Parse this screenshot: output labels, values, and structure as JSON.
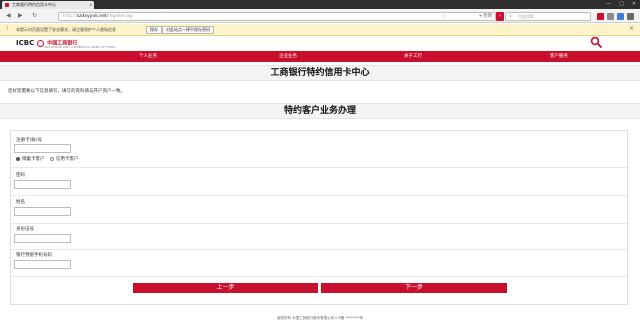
{
  "browser": {
    "tab_title": "工商银行特约信用卡中心",
    "tab_close": "x",
    "window_buttons": [
      "—",
      "□",
      "✕"
    ],
    "nav": {
      "back": "◀",
      "forward": "▶",
      "refresh": "↻"
    },
    "url_scheme": "http://",
    "url_host": "szdxyynk.net",
    "url_path": "/register.jsp",
    "url_right": "▾ 原网",
    "star": "☆",
    "go": "›",
    "search_placeholder": "百度搜索",
    "search_glyph": "⌕"
  },
  "infobar": {
    "icon": "!",
    "text": "本提示对页面设置了安全模式，请注意保护个人隐私信息",
    "allow_button": "保存",
    "never_button": "对此站点一律不保存密码",
    "close": "✕"
  },
  "bank": {
    "logo_text": "ICBC",
    "logo_cn": "中国工商银行",
    "logo_sub": "INDUSTRIAL AND COMMERCIAL BANK OF CHINA",
    "menu": [
      "个人业务",
      "企业业务",
      "关于工行",
      "客户服务"
    ],
    "page_title": "工商银行特约信用卡中心",
    "note": "您好您需要以下信息填写，填写的资料请与开户资户一致。",
    "section_title": "特约客户业务办理",
    "form": {
      "card_label": "注册卡(账)号",
      "account_type_options": [
        "储蓄卡客户",
        "信用卡客户"
      ],
      "password_label": "密码",
      "name_label": "姓名",
      "id_label": "身份证号",
      "phone_label": "银行预留手机号码"
    },
    "prev_button": "上一步",
    "next_button": "下一步",
    "footer": "版权所有 中国工商银行股份有限公司 ICP备 ********号"
  },
  "colors": {
    "brand_red": "#c8102e",
    "infobar_bg": "#fdf3c8"
  },
  "icons": [
    "tab-favicon-icon",
    "back-icon",
    "forward-icon",
    "refresh-icon",
    "star-icon",
    "search-icon",
    "info-icon",
    "close-icon",
    "icbc-logo-icon"
  ]
}
